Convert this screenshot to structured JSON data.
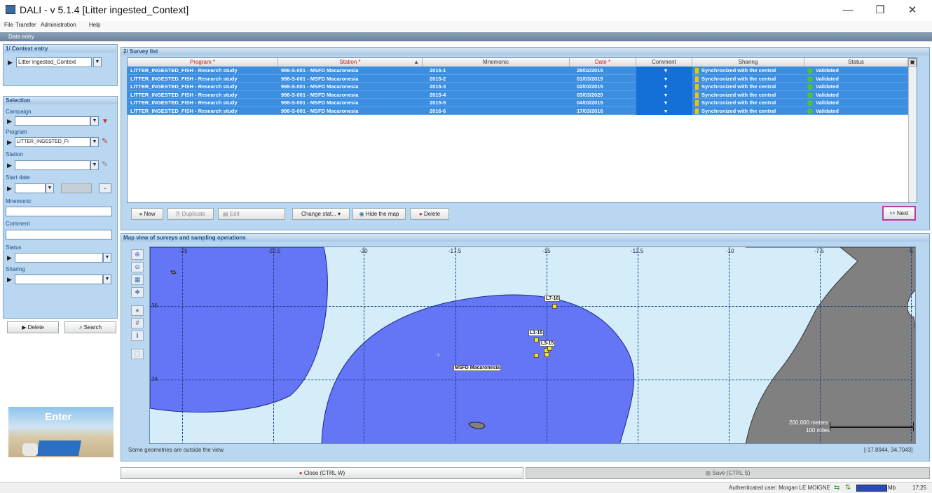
{
  "window": {
    "title": "DALI - v 5.1.4 [Litter ingested_Context]",
    "controls": [
      "—",
      "❐",
      "✕"
    ]
  },
  "menu": {
    "items": [
      "File",
      "Transfer",
      "Administration",
      "Help"
    ]
  },
  "data_entry_bar": {
    "label": "Data entry"
  },
  "context_entry": {
    "header": "1/ Context entry",
    "value": "Litter ingested_Context"
  },
  "selection": {
    "header": "Selection",
    "campaign_label": "Campaign",
    "campaign_value": "",
    "program_label": "Program",
    "program_value": "LITTER_INGESTED_FI",
    "station_label": "Station",
    "station_value": "",
    "start_date_label": "Start date",
    "start_date_value": "",
    "mnemonic_label": "Mnemonic",
    "mnemonic_value": "",
    "comment_label": "Comment",
    "comment_value": "",
    "status_label": "Status",
    "status_value": "",
    "sharing_label": "Sharing",
    "sharing_value": "",
    "delete_label": "Delete",
    "search_label": "Search"
  },
  "enter_image": {
    "caption": "Enter"
  },
  "survey_list": {
    "header": "2/ Survey list",
    "columns": [
      "Program *",
      "Station *",
      "Mnemonic",
      "Date *",
      "Comment",
      "Sharing",
      "Status"
    ],
    "rows": [
      {
        "program": "LITTER_INGESTED_FISH - Research study",
        "station": "998-S-001 - MSFD Macaronesia",
        "mnemonic": "2015-1",
        "date": "28/02/2015",
        "sharing": "Synchronized with the central",
        "status": "Validated"
      },
      {
        "program": "LITTER_INGESTED_FISH - Research study",
        "station": "998-S-001 - MSFD Macaronesia",
        "mnemonic": "2015-2",
        "date": "01/03/2015",
        "sharing": "Synchronized with the central",
        "status": "Validated"
      },
      {
        "program": "LITTER_INGESTED_FISH - Research study",
        "station": "998-S-001 - MSFD Macaronesia",
        "mnemonic": "2015-3",
        "date": "02/03/2015",
        "sharing": "Synchronized with the central",
        "status": "Validated"
      },
      {
        "program": "LITTER_INGESTED_FISH - Research study",
        "station": "998-S-001 - MSFD Macaronesia",
        "mnemonic": "2015-4",
        "date": "03/03/2020",
        "sharing": "Synchronized with the central",
        "status": "Validated"
      },
      {
        "program": "LITTER_INGESTED_FISH - Research study",
        "station": "998-S-001 - MSFD Macaronesia",
        "mnemonic": "2015-5",
        "date": "04/03/2015",
        "sharing": "Synchronized with the central",
        "status": "Validated"
      },
      {
        "program": "LITTER_INGESTED_FISH - Research study",
        "station": "998-S-001 - MSFD Macaronesia",
        "mnemonic": "2016-6",
        "date": "17/03/2016",
        "sharing": "Synchronized with the central",
        "status": "Validated"
      }
    ],
    "buttons": {
      "new": "New",
      "duplicate": "Duplicate",
      "edit": "Edit",
      "change_status": "Change stat...",
      "hide_map": "Hide the map",
      "delete": "Delete",
      "next": "Next"
    }
  },
  "map": {
    "header": "Map view of surveys and sampling operations",
    "lon_ticks": [
      "-25",
      "-22.5",
      "-20",
      "-17.5",
      "-15",
      "-12.5",
      "-10",
      "-7.5",
      "-5"
    ],
    "lat_ticks": [
      "36",
      "34"
    ],
    "area_label": "MSFD Macaronesia",
    "markers": [
      "L7-16",
      "L1-15",
      "L3-15"
    ],
    "scale_meters": "200,000 meters",
    "scale_miles": "100 miles",
    "outside_note": "Some geometries are outside the view",
    "coords": "[-17.8944, 34.7043]"
  },
  "bottom": {
    "close": "Close (CTRL W)",
    "save": "Save (CTRL S)"
  },
  "status_bar": {
    "user": "Authenticated user: Morgan LE MOIGNE",
    "memory": "Mb",
    "time": "17:25"
  }
}
